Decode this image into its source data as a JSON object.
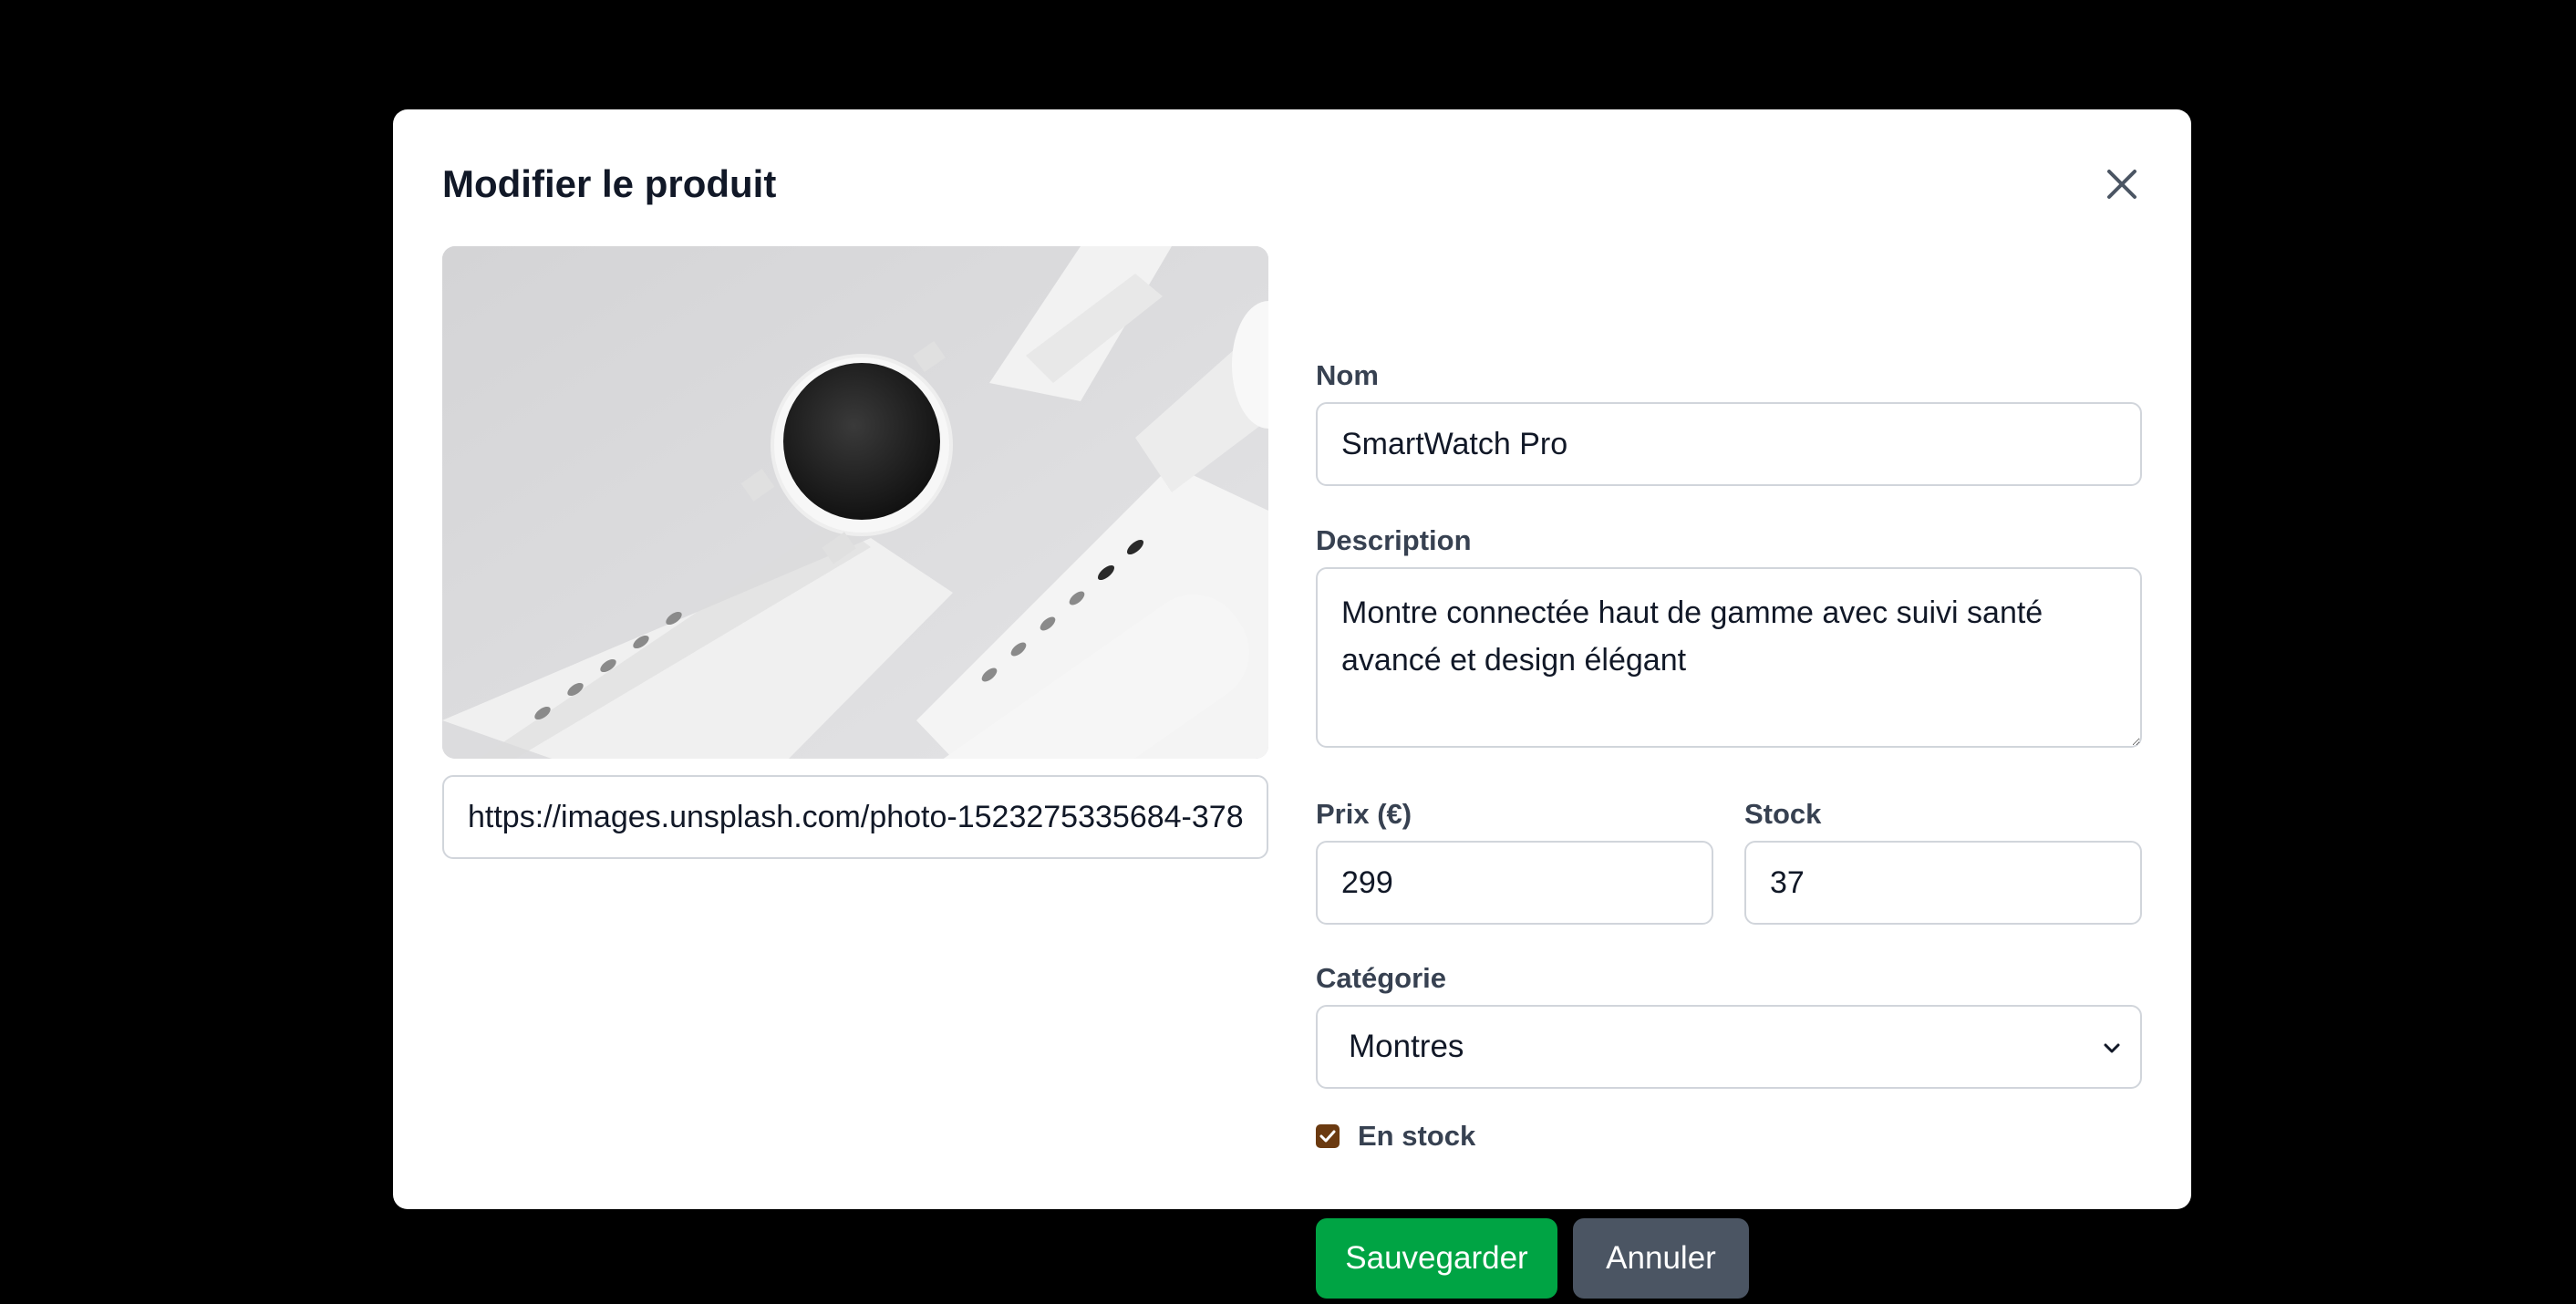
{
  "modal": {
    "title": "Modifier le produit",
    "close_icon": "close-icon"
  },
  "image": {
    "url": "https://images.unsplash.com/photo-1523275335684-37898b6baf30"
  },
  "form": {
    "name_label": "Nom",
    "name_value": "SmartWatch Pro",
    "description_label": "Description",
    "description_value": "Montre connectée haut de gamme avec suivi santé avancé et design élégant",
    "price_label": "Prix (€)",
    "price_value": "299",
    "stock_label": "Stock",
    "stock_value": "37",
    "category_label": "Catégorie",
    "category_value": "Montres",
    "in_stock_label": "En stock",
    "in_stock_checked": true
  },
  "actions": {
    "save_label": "Sauvegarder",
    "cancel_label": "Annuler"
  },
  "colors": {
    "save": "#00a444",
    "cancel": "#4b5563",
    "checkbox": "#6b3a10"
  }
}
